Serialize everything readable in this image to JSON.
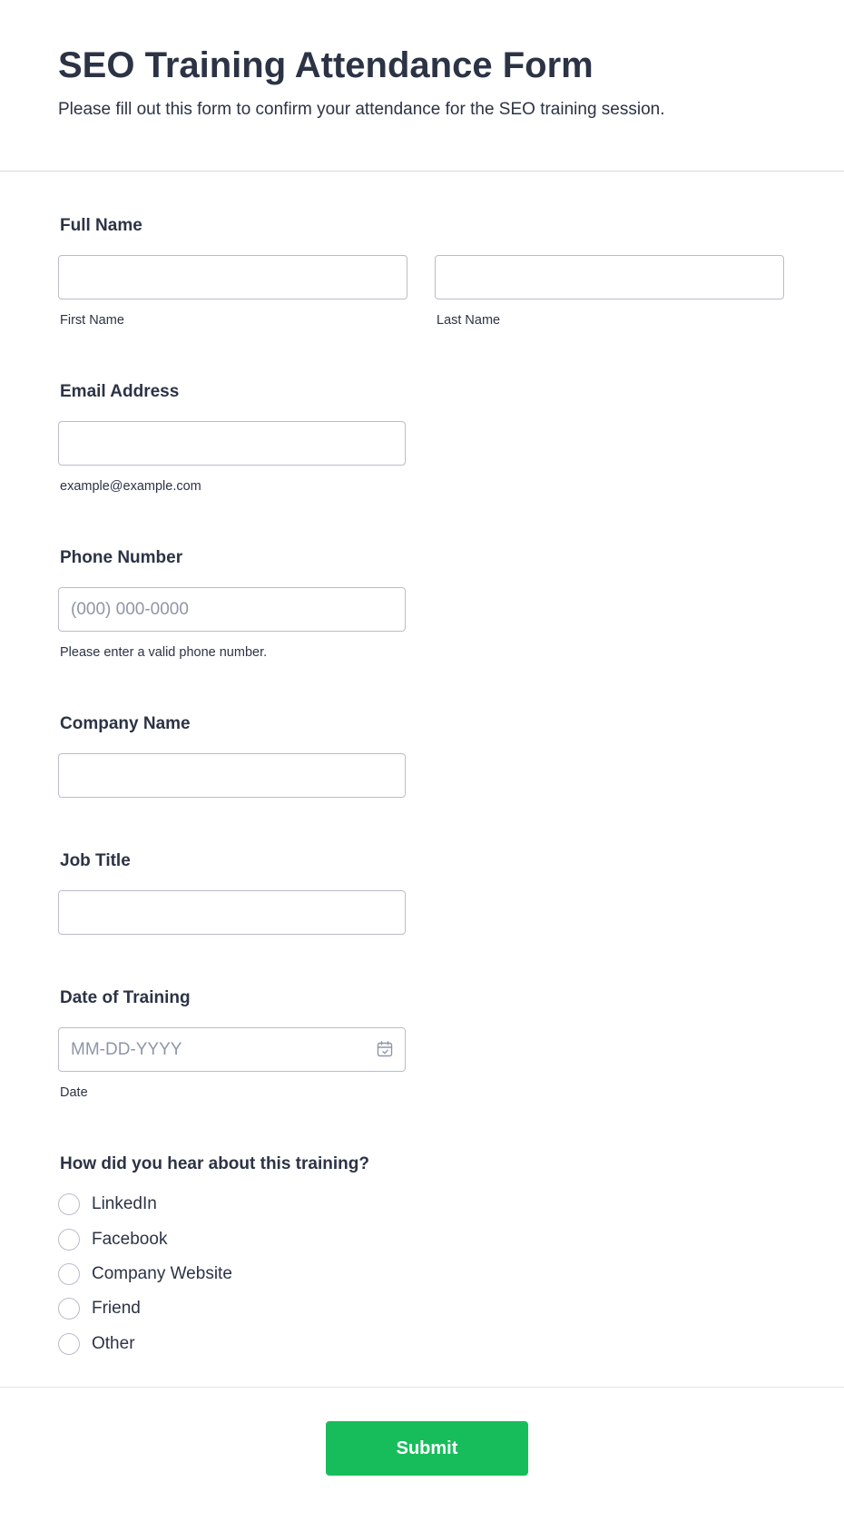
{
  "header": {
    "title": "SEO Training Attendance Form",
    "subtitle": "Please fill out this form to confirm your attendance for the SEO training session."
  },
  "fields": {
    "full_name": {
      "label": "Full Name",
      "first_sublabel": "First Name",
      "last_sublabel": "Last Name",
      "first_value": "",
      "last_value": ""
    },
    "email": {
      "label": "Email Address",
      "sublabel": "example@example.com",
      "value": ""
    },
    "phone": {
      "label": "Phone Number",
      "placeholder": "(000) 000-0000",
      "sublabel": "Please enter a valid phone number.",
      "value": ""
    },
    "company": {
      "label": "Company Name",
      "value": ""
    },
    "job_title": {
      "label": "Job Title",
      "value": ""
    },
    "date": {
      "label": "Date of Training",
      "placeholder": "MM-DD-YYYY",
      "sublabel": "Date",
      "icon": "calendar-icon",
      "value": ""
    },
    "referral": {
      "label": "How did you hear about this training?",
      "options": [
        "LinkedIn",
        "Facebook",
        "Company Website",
        "Friend",
        "Other"
      ],
      "selected": null
    }
  },
  "submit": {
    "label": "Submit"
  },
  "colors": {
    "text": "#2c3345",
    "border": "#b9bdcb",
    "placeholder": "#8f96a8",
    "submit_bg": "#18bd5b",
    "submit_text": "#ffffff"
  }
}
